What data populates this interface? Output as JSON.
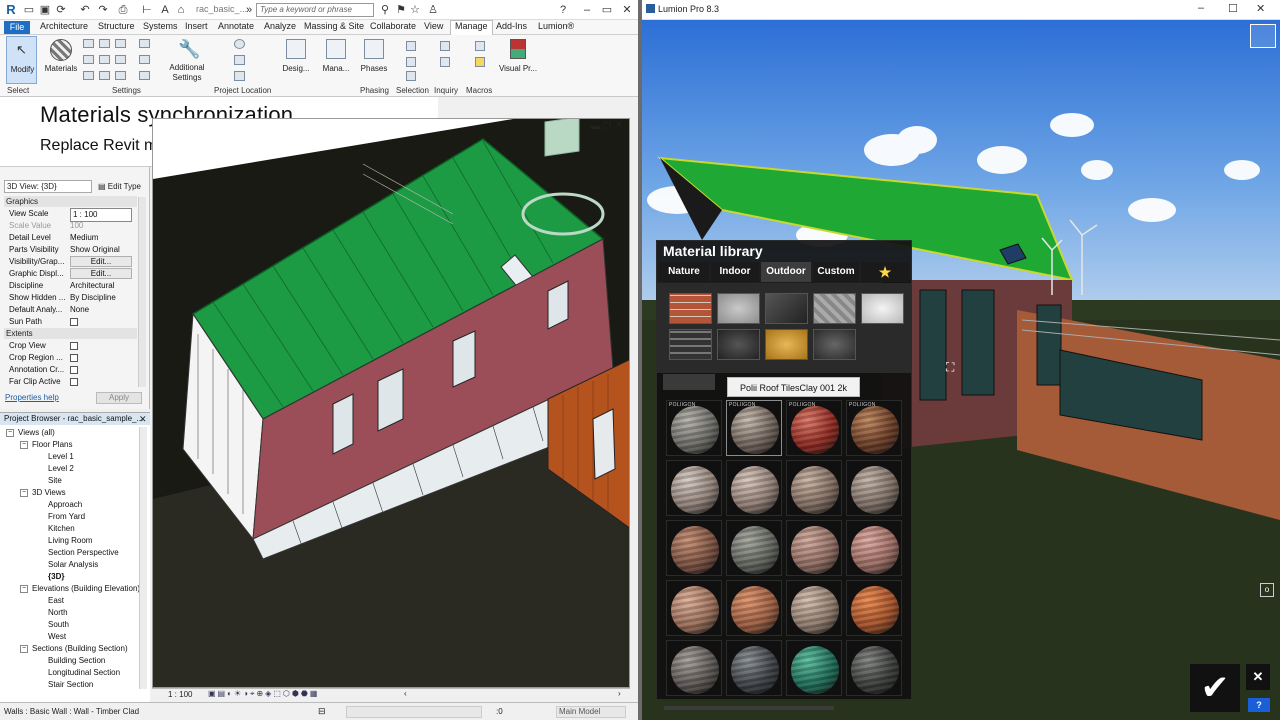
{
  "revit": {
    "doc_name": "rac_basic_...",
    "search_placeholder": "Type a keyword or phrase",
    "menu": [
      "File",
      "Architecture",
      "Structure",
      "Systems",
      "Insert",
      "Annotate",
      "Analyze",
      "Massing & Site",
      "Collaborate",
      "View",
      "Manage",
      "Add-Ins",
      "Lumion®"
    ],
    "active_menu": "Manage",
    "ribbon_buttons": {
      "modify": "Modify",
      "materials": "Materials",
      "additional_settings_1": "Additional",
      "additional_settings_2": "Settings",
      "design_options": "Desig...",
      "manage_links": "Mana...",
      "phases": "Phases",
      "visual_programming": "Visual Pr..."
    },
    "ribbon_panels": [
      "Select",
      "Settings",
      "Project Location",
      "Phasing",
      "Selection",
      "Inquiry",
      "Macros"
    ],
    "properties": {
      "type_selector": "3D View: {3D}",
      "edit_type": "Edit Type",
      "graphics_header": "Graphics",
      "extents_header": "Extents",
      "rows": [
        {
          "key": "View Scale",
          "value": "1 : 100"
        },
        {
          "key": "Scale Value",
          "value": "100"
        },
        {
          "key": "Detail Level",
          "value": "Medium"
        },
        {
          "key": "Parts Visibility",
          "value": "Show Original"
        },
        {
          "key": "Visibility/Grap...",
          "value": "Edit..."
        },
        {
          "key": "Graphic Displ...",
          "value": "Edit..."
        },
        {
          "key": "Discipline",
          "value": "Architectural"
        },
        {
          "key": "Show Hidden ...",
          "value": "By Discipline"
        },
        {
          "key": "Default Analy...",
          "value": "None"
        },
        {
          "key": "Sun Path",
          "value": ""
        }
      ],
      "extents_rows": [
        "Crop View",
        "Crop Region ...",
        "Annotation Cr...",
        "Far Clip Active"
      ],
      "properties_help": "Properties help",
      "apply": "Apply"
    },
    "browser": {
      "title": "Project Browser - rac_basic_sample_...",
      "items": [
        {
          "label": "Views (all)",
          "level": 0,
          "toggle": "−"
        },
        {
          "label": "Floor Plans",
          "level": 1,
          "toggle": "−"
        },
        {
          "label": "Level 1",
          "level": 2
        },
        {
          "label": "Level 2",
          "level": 2
        },
        {
          "label": "Site",
          "level": 2
        },
        {
          "label": "3D Views",
          "level": 1,
          "toggle": "−"
        },
        {
          "label": "Approach",
          "level": 2
        },
        {
          "label": "From Yard",
          "level": 2
        },
        {
          "label": "Kitchen",
          "level": 2
        },
        {
          "label": "Living Room",
          "level": 2
        },
        {
          "label": "Section Perspective",
          "level": 2
        },
        {
          "label": "Solar Analysis",
          "level": 2
        },
        {
          "label": "{3D}",
          "level": 2
        },
        {
          "label": "Elevations (Building Elevation)",
          "level": 1,
          "toggle": "−"
        },
        {
          "label": "East",
          "level": 2
        },
        {
          "label": "North",
          "level": 2
        },
        {
          "label": "South",
          "level": 2
        },
        {
          "label": "West",
          "level": 2
        },
        {
          "label": "Sections (Building Section)",
          "level": 1,
          "toggle": "−"
        },
        {
          "label": "Building Section",
          "level": 2
        },
        {
          "label": "Longitudinal Section",
          "level": 2
        },
        {
          "label": "Stair Section",
          "level": 2
        }
      ]
    },
    "view_scale": "1 : 100",
    "status_text": "Walls : Basic Wall : Wall - Timber Clad",
    "status_zero": ":0",
    "main_model": "Main Model"
  },
  "overlay": {
    "title": "Materials synchronization",
    "subtitle": "Replace Revit materials with Lumion materials"
  },
  "lumion": {
    "window_title": "Lumion Pro 8.3",
    "library_title": "Material library",
    "tabs": [
      "Nature",
      "Indoor",
      "Outdoor",
      "Custom"
    ],
    "active_tab": "Outdoor",
    "favorite_icon": "star-icon",
    "category_swatches": [
      "brick",
      "concrete",
      "metal",
      "tiles",
      "plaster",
      "roof-tiles",
      "gravel",
      "wood",
      "asphalt"
    ],
    "tooltip": "Polii Roof TilesClay 001 2k",
    "poliigon_badge": "POLIIGON",
    "spheres": [
      {
        "base": "#6a6a66",
        "hi": "#b8b4ad",
        "badge": true
      },
      {
        "base": "#6e625a",
        "hi": "#c9bdb0",
        "badge": true,
        "selected": true
      },
      {
        "base": "#8e2a22",
        "hi": "#e07a6a",
        "badge": true
      },
      {
        "base": "#6b3d27",
        "hi": "#c48a60",
        "badge": true
      },
      {
        "base": "#8e7f76",
        "hi": "#d9cec6"
      },
      {
        "base": "#8d7b72",
        "hi": "#dccabf"
      },
      {
        "base": "#7f6b60",
        "hi": "#cdb6a6"
      },
      {
        "base": "#7b6d63",
        "hi": "#c7b8ab"
      },
      {
        "base": "#7b5141",
        "hi": "#c99378"
      },
      {
        "base": "#5f625c",
        "hi": "#a8aaa2"
      },
      {
        "base": "#8f6c61",
        "hi": "#d6ada0"
      },
      {
        "base": "#9a6b62",
        "hi": "#e2ada3"
      },
      {
        "base": "#9a6e5a",
        "hi": "#e0b29b"
      },
      {
        "base": "#9a5d42",
        "hi": "#e3976f"
      },
      {
        "base": "#8e7a6c",
        "hi": "#d6c2b2"
      },
      {
        "base": "#a3522a",
        "hi": "#f08c52"
      },
      {
        "base": "#5a5552",
        "hi": "#a8a29c"
      },
      {
        "base": "#3d4145",
        "hi": "#8d9296"
      },
      {
        "base": "#1f6b56",
        "hi": "#5ec1a0"
      },
      {
        "base": "#3a3c3a",
        "hi": "#858784"
      }
    ],
    "ok_icon": "checkmark-icon",
    "close_icon": "close-icon",
    "help_label": "?"
  }
}
